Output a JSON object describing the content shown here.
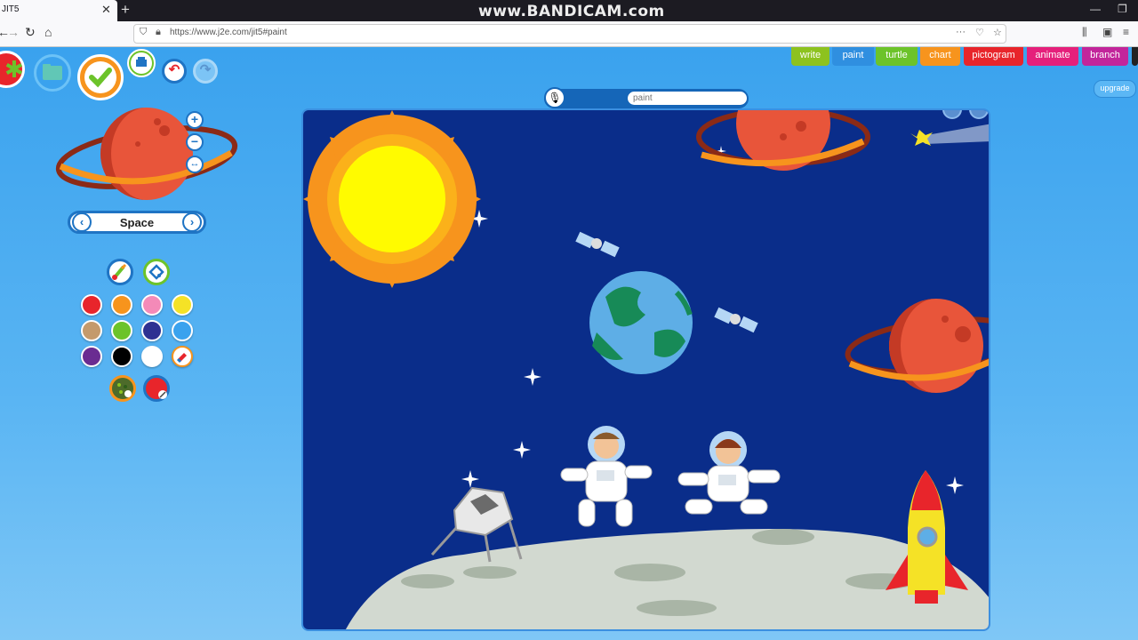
{
  "browser": {
    "tab_title": "JIT5",
    "tab_close": "✕",
    "new_tab": "+",
    "url": "https://www.j2e.com/jit5#paint",
    "watermark": "www.BANDICAM.com"
  },
  "mode_tabs": [
    {
      "label": "write",
      "color": "#8dc21f"
    },
    {
      "label": "paint",
      "color": "#2f8fe0"
    },
    {
      "label": "turtle",
      "color": "#6cc32a"
    },
    {
      "label": "chart",
      "color": "#f7941d"
    },
    {
      "label": "pictogram",
      "color": "#e8252b"
    },
    {
      "label": "animate",
      "color": "#e5207b"
    },
    {
      "label": "branch",
      "color": "#c2259b"
    }
  ],
  "upgrade_label": "upgrade",
  "title_input": {
    "placeholder": "paint"
  },
  "theme": {
    "name": "Space",
    "prev": "‹",
    "next": "›"
  },
  "zoom": {
    "in": "+",
    "out": "−",
    "fit": "↔"
  },
  "palette": [
    "#e8252b",
    "#f7941d",
    "#f48ab8",
    "#f5e226",
    "#c49a6c",
    "#6cc32a",
    "#2e3192",
    "#3aa2ee",
    "#6a2c91",
    "#000000",
    "#ffffff"
  ]
}
